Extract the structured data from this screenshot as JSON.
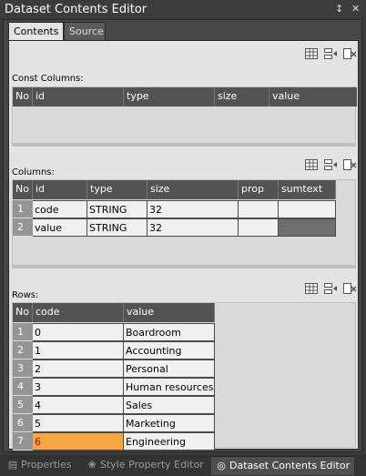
{
  "window": {
    "title": "Dataset Contents Editor",
    "pin": "⭝",
    "close": "✕"
  },
  "tabs": {
    "contents": "Contents",
    "source": "Source"
  },
  "const_columns": {
    "label": "Const Columns:",
    "headers": [
      "No",
      "id",
      "type",
      "size",
      "value"
    ]
  },
  "columns": {
    "label": "Columns:",
    "headers": [
      "No",
      "id",
      "type",
      "size",
      "prop",
      "sumtext"
    ],
    "rows": [
      {
        "no": "1",
        "id": "code",
        "type": "STRING",
        "size": "32",
        "prop": "",
        "sumtext": ""
      },
      {
        "no": "2",
        "id": "value",
        "type": "STRING",
        "size": "32",
        "prop": "",
        "sumtext": ""
      }
    ]
  },
  "rows_section": {
    "label": "Rows:",
    "headers": [
      "No",
      "code",
      "value"
    ],
    "rows": [
      {
        "no": "1",
        "code": "0",
        "value": "Boardroom"
      },
      {
        "no": "2",
        "code": "1",
        "value": "Accounting"
      },
      {
        "no": "3",
        "code": "2",
        "value": "Personal"
      },
      {
        "no": "4",
        "code": "3",
        "value": "Human resources"
      },
      {
        "no": "5",
        "code": "4",
        "value": "Sales"
      },
      {
        "no": "6",
        "code": "5",
        "value": "Marketing"
      },
      {
        "no": "7",
        "code": "6",
        "value": "Engineering"
      }
    ]
  },
  "toolbar_icons": [
    "grid-add-icon",
    "insert-row-icon",
    "delete-row-icon"
  ],
  "bottom_tabs": {
    "properties": "Properties",
    "style_property_editor": "Style Property Editor",
    "dataset_contents_editor": "Dataset Contents Editor"
  },
  "colors": {
    "highlight": "#f5a742",
    "highlight_text": "#c40000",
    "header": "#535353",
    "row_number": "#959595"
  }
}
